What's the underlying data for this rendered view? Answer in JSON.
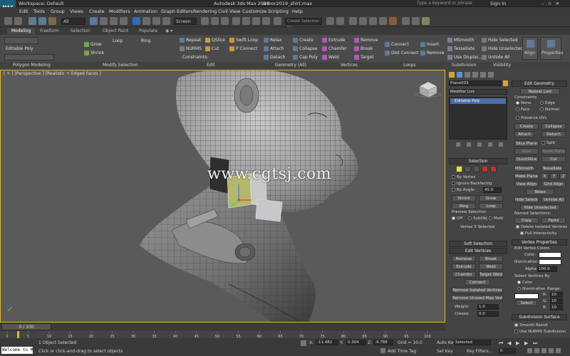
{
  "window": {
    "workspace": "Workspace: Default",
    "title": "Autodesk 3ds Max 2016",
    "filename": "armor2019_shirt.max",
    "search_placeholder": "Type a keyword or phrase",
    "sign_in": "Sign In"
  },
  "menu": [
    "Edit",
    "Tools",
    "Group",
    "Views",
    "Create",
    "Modifiers",
    "Animation",
    "Graph Editors",
    "Rendering",
    "Civil View",
    "Customize",
    "Scripting",
    "Help"
  ],
  "toolbar": {
    "filter": "All",
    "ref_coord": "Screen",
    "named_selection": "Create Selection Se"
  },
  "ribbon_tabs": [
    "Modeling",
    "Freeform",
    "Selection",
    "Object Paint",
    "Populate"
  ],
  "ribbon": {
    "editable_poly": "Editable Poly",
    "grow": "Grow",
    "shrink": "Shrink",
    "loop": "Loop",
    "ring": "Ring",
    "repeat": "Repeat",
    "qslice": "QSlice",
    "swift_loop": "Swift Loop",
    "nurms": "NURMS",
    "cut": "Cut",
    "p_connect": "P Connect",
    "constraints": "Constraints:",
    "relax": "Relax",
    "create": "Create",
    "attach": "Attach",
    "collapse": "Collapse",
    "detach": "Detach",
    "cap_poly": "Cap Poly",
    "extrude": "Extrude",
    "remove": "Remove",
    "chamfer": "Chamfer",
    "break": "Break",
    "weld": "Weld",
    "target": "Target",
    "connect": "Connect",
    "dist_connect": "Dist Connect",
    "insert": "Insert",
    "remove2": "Remove",
    "msmooth": "MSmooth",
    "tessellate": "Tessellate",
    "use_displac": "Use Displac...",
    "hide_selected": "Hide Selected",
    "hide_unselected": "Hide Unselected",
    "unhide_all": "Unhide All",
    "align": "Align",
    "properties": "Properties"
  },
  "ribbon_groups": [
    "Polygon Modeling",
    "Modify Selection",
    "Edit",
    "Geometry (All)",
    "Vertices",
    "Loops",
    "Subdivision",
    "Visibility"
  ],
  "viewport": {
    "label": "[ + ] [Perspective ] [Realistic + Edged Faces ]",
    "watermark": "www.cgtsj.com"
  },
  "command_panel": {
    "object_name": "Plane003",
    "modifier_list": "Modifier List",
    "stack_item": "Editable Poly",
    "selection_header": "Selection",
    "by_vertex": "By Vertex",
    "ignore_backfacing": "Ignore Backfacing",
    "by_angle": "By Angle:",
    "by_angle_val": "45.0",
    "shrink": "Shrink",
    "grow": "Grow",
    "ring": "Ring",
    "loop": "Loop",
    "preview_selection": "Preview Selection",
    "off": "Off",
    "subobj": "SubObj",
    "multi": "Multi",
    "vertices_selected": "Vertex 5 Selected",
    "soft_selection": "Soft Selection",
    "edit_vertices": "Edit Vertices",
    "remove": "Remove",
    "break": "Break",
    "extrude": "Extrude",
    "weld": "Weld",
    "chamfer": "Chamfer",
    "target_weld": "Target Weld",
    "connect": "Connect",
    "remove_isolated": "Remove Isolated Vertices",
    "remove_unused": "Remove Unused Map Verts",
    "weight": "Weight:",
    "weight_val": "1.0",
    "crease": "Crease:",
    "crease_val": "0.0",
    "edit_geometry": "Edit Geometry",
    "repeat_last": "Repeat Last",
    "constraints": "Constraints",
    "none": "None",
    "edge": "Edge",
    "face": "Face",
    "normal": "Normal",
    "preserve_uvs": "Preserve UVs",
    "create": "Create",
    "collapse": "Collapse",
    "attach": "Attach",
    "detach": "Detach",
    "slice_plane": "Slice Plane",
    "split": "Split",
    "slice": "Slice",
    "reset_plane": "Reset Plane",
    "quickslice": "QuickSlice",
    "cut": "Cut",
    "msmooth": "MSmooth",
    "tessellate": "Tessellate",
    "make_planar": "Make Planar",
    "x": "X",
    "y": "Y",
    "z": "Z",
    "view_align": "View Align",
    "grid_align": "Grid Align",
    "relax": "Relax",
    "hide_selected": "Hide Selected",
    "unhide_all": "Unhide All",
    "hide_unselected": "Hide Unselected",
    "named_selections": "Named Selections:",
    "copy": "Copy",
    "paste": "Paste",
    "delete_isolated": "Delete Isolated Vertices",
    "full_interactivity": "Full Interactivity",
    "vertex_properties": "Vertex Properties",
    "edit_vertex_colors": "Edit Vertex Colors",
    "color": "Color:",
    "illumination": "Illumination:",
    "alpha": "Alpha:",
    "alpha_val": "100.0",
    "select_vertices_by": "Select Vertices By",
    "color_opt": "Color",
    "illumination_opt": "Illumination",
    "range": "Range:",
    "r": "R:",
    "g": "G:",
    "b": "B:",
    "range_val": "10",
    "select": "Select",
    "subdivision_surface": "Subdivision Surface",
    "smooth_result": "Smooth Result",
    "use_nurms": "Use NURMS Subdivision"
  },
  "timeline": {
    "frame": "0 / 100",
    "ticks": [
      "0",
      "5",
      "10",
      "15",
      "20",
      "25",
      "30",
      "35",
      "40",
      "45",
      "50",
      "55",
      "60",
      "65",
      "70",
      "75",
      "80",
      "85",
      "90",
      "95",
      "100"
    ]
  },
  "status": {
    "welcome": "Welcome to M",
    "objects_selected": "1 Object Selected",
    "prompt": "Click or click-and-drag to select objects",
    "x_label": "X:",
    "x_val": "-11.482",
    "y_label": "Y:",
    "y_val": "0.304",
    "z_label": "Z:",
    "z_val": "-9.788",
    "grid": "Grid = 10.0",
    "add_time_tag": "Add Time Tag",
    "auto_key": "Auto Key",
    "set_key": "Set Key",
    "selected": "Selected",
    "key_filters": "Key Filters...",
    "frame_val": "0"
  },
  "colors": {
    "accent_yellow": "#e3b629",
    "viewport_bg": "#5a5a5a",
    "ui_bg": "#444444",
    "logo": "#1e5c7a"
  }
}
